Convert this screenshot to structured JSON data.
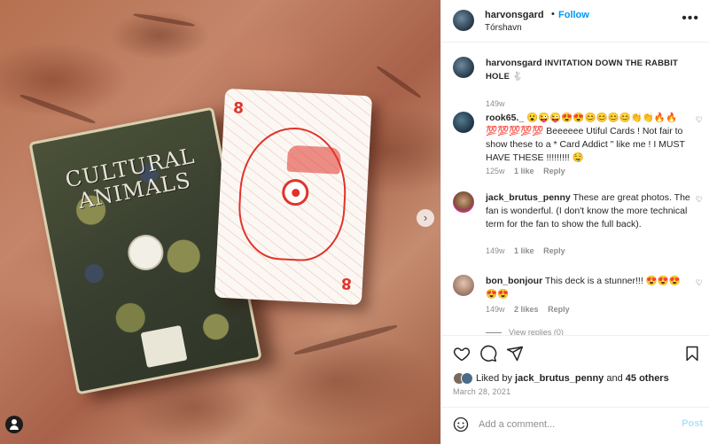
{
  "post": {
    "username": "harvonsgard",
    "separator": "•",
    "follow_label": "Follow",
    "location": "Tórshavn",
    "more_label": "•••"
  },
  "image": {
    "deck_title_line1": "CULTURAL",
    "deck_title_line2": "ANIMALS",
    "card_rank": "8",
    "next_label": "›"
  },
  "comments": [
    {
      "username": "harvonsgard",
      "text": "INVITATION DOWN THE RABBIT HOLE 🐇",
      "time": "149w"
    },
    {
      "username": "rook65._",
      "text": "😮😜😜😍😍😊😊😊😊👏👏🔥🔥💯💯💯💯💯 Beeeeee Utiful Cards ! Not fair to show these to a * Card Addict \" like me ! I MUST HAVE THESE !!!!!!!!! 🤤",
      "time": "125w",
      "likes": "1 like",
      "reply": "Reply"
    },
    {
      "username": "jack_brutus_penny",
      "text": "These are great photos. The fan is wonderful. (I don't know the more technical term for the fan to show the full back).",
      "time": "149w",
      "likes": "1 like",
      "reply": "Reply"
    },
    {
      "username": "bon_bonjour",
      "text": "This deck is a stunner!!! 😍😍😍😍😍",
      "time": "149w",
      "likes": "2 likes",
      "reply": "Reply"
    }
  ],
  "view_replies": "View replies (0)",
  "likes": {
    "prefix": "Liked by",
    "user": "jack_brutus_penny",
    "and": "and",
    "others": "45 others"
  },
  "date": "March 28, 2021",
  "add_comment": {
    "placeholder": "Add a comment...",
    "post_label": "Post"
  },
  "colors": {
    "accent": "#0095f6",
    "post_disabled": "#b2dffc",
    "card_red": "#e0342a",
    "muted": "#8e8e8e"
  }
}
